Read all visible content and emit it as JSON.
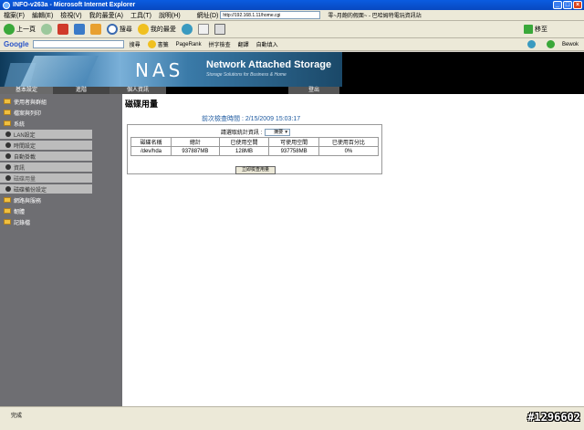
{
  "window": {
    "title": "INFO-v263a - Microsoft Internet Explorer"
  },
  "menu": [
    "檔案(F)",
    "編輯(E)",
    "檢視(V)",
    "我的最愛(A)",
    "工具(T)",
    "說明(H)"
  ],
  "address": {
    "label": "網址(D)",
    "url": "http://192.168.1.11/home.cgi"
  },
  "links": [
    "零~月飽的假面~ - 巴哈姆特電玩資訊站"
  ],
  "toolbar": {
    "back": "上一頁",
    "search": "搜尋",
    "favorites": "我的最愛",
    "go": "移至"
  },
  "google": {
    "logo": "Google",
    "search_label": "搜尋",
    "bookmarks": "書籤",
    "pagerank": "PageRank",
    "check": "拼字檢查",
    "translate": "翻譯",
    "autofill": "自動填入",
    "user": "Bewok"
  },
  "nas": {
    "logo": "NAS",
    "title": "Network Attached Storage",
    "subtitle": "Storage Solutions for Business & Home"
  },
  "tabs": {
    "basic": "基本設定",
    "advanced": "進階",
    "personal": "個人資訊",
    "logout": "登出"
  },
  "sidebar": [
    {
      "label": "使用者與群組",
      "type": "folder"
    },
    {
      "label": "檔案與列印",
      "type": "folder"
    },
    {
      "label": "系統",
      "type": "folder"
    },
    {
      "label": "LAN設定",
      "type": "sub"
    },
    {
      "label": "時間設定",
      "type": "sub"
    },
    {
      "label": "自動掛載",
      "type": "sub"
    },
    {
      "label": "資訊",
      "type": "sub"
    },
    {
      "label": "磁碟用量",
      "type": "sub"
    },
    {
      "label": "磁碟備份設定",
      "type": "sub"
    },
    {
      "label": "網路與服務",
      "type": "folder"
    },
    {
      "label": "韌體",
      "type": "folder"
    },
    {
      "label": "記錄檔",
      "type": "folder"
    }
  ],
  "main": {
    "title": "磁碟用量",
    "last_check_label": "前次檢查時間 : ",
    "last_check_value": "2/15/2009 15:03:17",
    "select_label": "請選取統計資訊 :",
    "select_value": "摘要",
    "columns": [
      "磁碟名稱",
      "總計",
      "已使用空間",
      "可使用空間",
      "已使用百分比"
    ],
    "rows": [
      [
        "/dev/hda",
        "937887MB",
        "128MB",
        "937758MB",
        "0%"
      ]
    ],
    "check_button": "立即檢查用量"
  },
  "status": {
    "text": "完成",
    "watermark": "#1296602"
  }
}
